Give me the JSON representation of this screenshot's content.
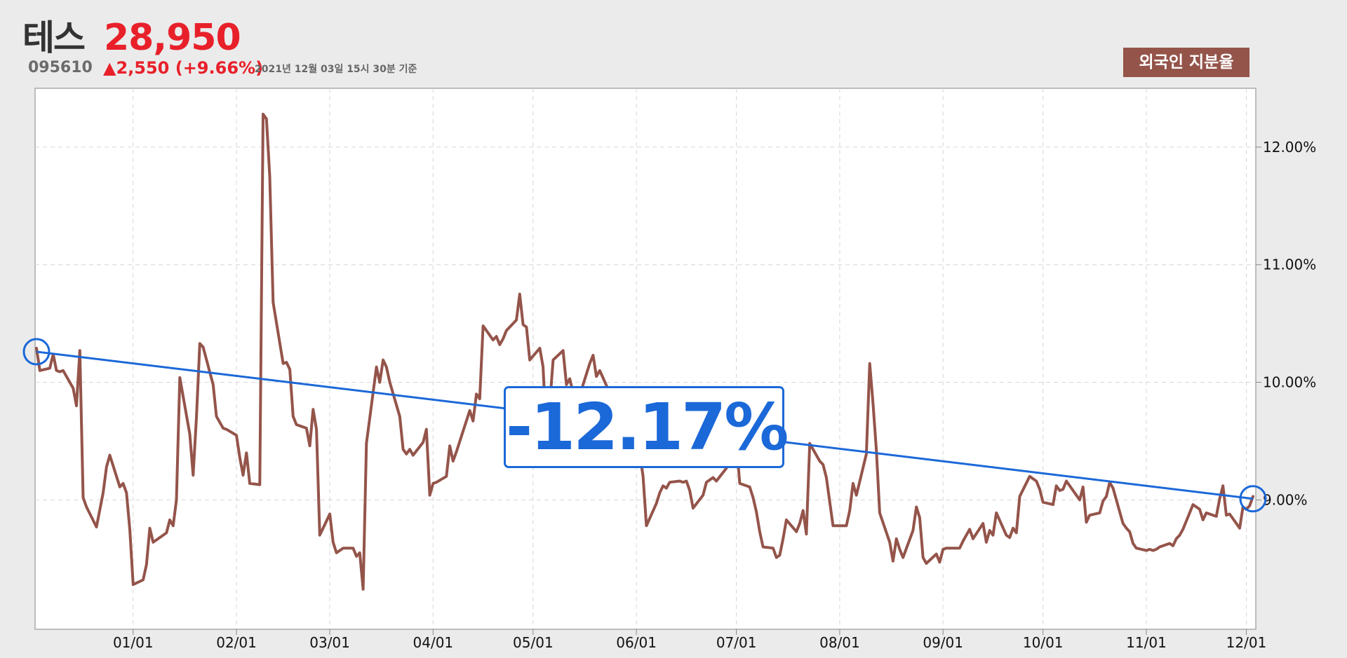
{
  "header": {
    "stock_name": "테스",
    "price": "28,950",
    "code": "095610",
    "change": "▲2,550 (+9.66%)",
    "timestamp": "2021년 12월 03일 15시 30분 기준",
    "legend_label": "외국인 지분율"
  },
  "change_label": "-12.17%",
  "colors": {
    "series": "#94544a",
    "trend": "#1b68d8",
    "price_up": "#e8202a",
    "background": "#ebebeb"
  },
  "chart_data": {
    "type": "line",
    "title": "",
    "xlabel": "",
    "ylabel": "",
    "x_ticks": [
      "01/01",
      "02/01",
      "03/01",
      "04/01",
      "05/01",
      "06/01",
      "07/01",
      "08/01",
      "09/01",
      "10/01",
      "11/01",
      "12/01"
    ],
    "y_ticks": [
      "9.00%",
      "10.00%",
      "11.00%",
      "12.00%"
    ],
    "ylim": [
      7.9,
      12.5
    ],
    "x_range": [
      "2020-12-03",
      "2021-12-03"
    ],
    "grid": true,
    "y_axis_side": "right",
    "series": [
      {
        "values": [
          10.29,
          10.1,
          10.12,
          10.24,
          10.1,
          10.09,
          10.1,
          9.95,
          9.8,
          10.27,
          9.02,
          8.94,
          8.77,
          9.06,
          9.28,
          9.38,
          9.11,
          9.14,
          9.06,
          8.75,
          8.28,
          8.32,
          8.45,
          8.76,
          8.64,
          8.66,
          8.72,
          8.83,
          8.78,
          9.0,
          10.04,
          9.56,
          9.21,
          9.7,
          10.33,
          10.3,
          9.98,
          9.71,
          9.61,
          9.6,
          9.55,
          9.36,
          9.21,
          9.4,
          9.14,
          9.13,
          12.28,
          12.24,
          11.75,
          10.68,
          10.16,
          10.17,
          10.11,
          9.71,
          9.64,
          9.61,
          9.46,
          9.77,
          9.6,
          8.7,
          8.88,
          8.64,
          8.55,
          8.59,
          8.59,
          8.52,
          8.55,
          8.24,
          9.48,
          10.13,
          10.0,
          10.19,
          10.13,
          10.0,
          9.71,
          9.43,
          9.39,
          9.43,
          9.38,
          9.49,
          9.6,
          9.04,
          9.14,
          9.15,
          9.2,
          9.46,
          9.33,
          9.41,
          9.76,
          9.67,
          9.9,
          9.86,
          10.48,
          10.36,
          10.39,
          10.32,
          10.37,
          10.44,
          10.53,
          10.75,
          10.49,
          10.47,
          10.19,
          10.29,
          10.13,
          9.53,
          9.81,
          10.19,
          10.27,
          9.98,
          10.03,
          9.91,
          9.8,
          10.16,
          10.23,
          10.05,
          10.1,
          9.91,
          9.8,
          9.7,
          9.73,
          9.73,
          9.61,
          9.5,
          9.4,
          9.2,
          8.78,
          8.97,
          9.06,
          9.12,
          9.1,
          9.15,
          9.16,
          9.15,
          9.16,
          9.08,
          8.93,
          9.04,
          9.15,
          9.19,
          9.16,
          9.27,
          9.35,
          9.45,
          9.5,
          9.14,
          9.11,
          9.02,
          8.9,
          8.73,
          8.6,
          8.59,
          8.51,
          8.53,
          8.67,
          8.83,
          8.73,
          8.8,
          8.91,
          8.71,
          9.48,
          9.33,
          9.3,
          9.19,
          8.78,
          8.78,
          8.78,
          8.91,
          9.14,
          9.04,
          9.39,
          10.16,
          9.82,
          9.42,
          8.89,
          8.64,
          8.48,
          8.67,
          8.58,
          8.51,
          8.74,
          8.94,
          8.85,
          8.51,
          8.46,
          8.54,
          8.47,
          8.58,
          8.59,
          8.59,
          8.65,
          8.7,
          8.75,
          8.67,
          8.8,
          8.64,
          8.74,
          8.7,
          8.89,
          8.7,
          8.68,
          8.76,
          8.72,
          9.03,
          9.2,
          9.18,
          9.16,
          9.09,
          8.98,
          8.96,
          9.12,
          9.08,
          9.09,
          9.16,
          9.0,
          9.11,
          8.81,
          8.87,
          8.89,
          8.99,
          9.03,
          9.15,
          9.1,
          8.8,
          8.76,
          8.73,
          8.63,
          8.59,
          8.57,
          8.58,
          8.57,
          8.58,
          8.6,
          8.63,
          8.61,
          8.67,
          8.7,
          8.75,
          8.96,
          8.92,
          8.83,
          8.89,
          8.86,
          9.01,
          9.12,
          8.87,
          8.88,
          8.76,
          8.94,
          8.92,
          8.95,
          9.03
        ]
      }
    ],
    "trend_line": {
      "start": 10.26,
      "end": 9.01,
      "change_pct": -12.17
    }
  }
}
